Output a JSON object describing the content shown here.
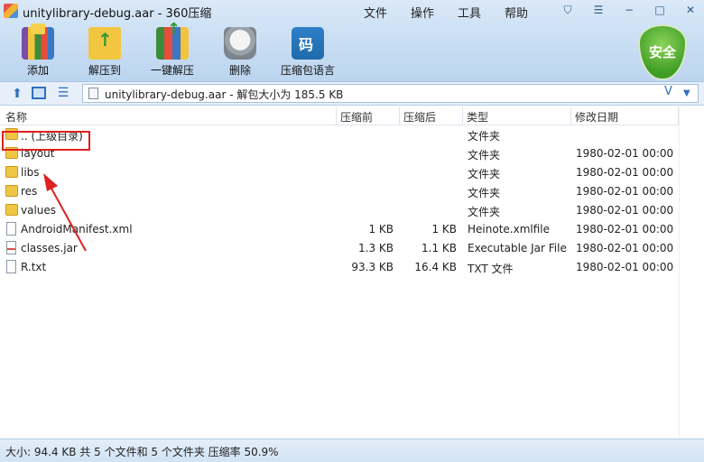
{
  "window": {
    "title": "unitylibrary-debug.aar - 360压缩",
    "menu": [
      "文件",
      "操作",
      "工具",
      "帮助"
    ],
    "controls": [
      "shirt-icon",
      "minimize",
      "maximize",
      "close"
    ]
  },
  "toolbar": {
    "buttons": [
      {
        "label": "添加",
        "icon": "add-archive-icon"
      },
      {
        "label": "解压到",
        "icon": "extract-to-icon"
      },
      {
        "label": "一键解压",
        "icon": "one-click-extract-icon"
      },
      {
        "label": "删除",
        "icon": "delete-icon"
      },
      {
        "label": "压缩包语言",
        "icon": "archive-language-icon"
      }
    ],
    "security_badge": "安全"
  },
  "address": {
    "path": "unitylibrary-debug.aar - 解包大小为 185.5 KB"
  },
  "table": {
    "columns": [
      "名称",
      "压缩前",
      "压缩后",
      "类型",
      "修改日期"
    ],
    "rows": [
      {
        "name": ".. (上级目录)",
        "before": "",
        "after": "",
        "type": "文件夹",
        "date": "",
        "icon": "folder-icon"
      },
      {
        "name": "layout",
        "before": "",
        "after": "",
        "type": "文件夹",
        "date": "1980-02-01 00:00",
        "icon": "folder-icon"
      },
      {
        "name": "libs",
        "before": "",
        "after": "",
        "type": "文件夹",
        "date": "1980-02-01 00:00",
        "icon": "folder-icon"
      },
      {
        "name": "res",
        "before": "",
        "after": "",
        "type": "文件夹",
        "date": "1980-02-01 00:00",
        "icon": "folder-icon"
      },
      {
        "name": "values",
        "before": "",
        "after": "",
        "type": "文件夹",
        "date": "1980-02-01 00:00",
        "icon": "folder-icon"
      },
      {
        "name": "AndroidManifest.xml",
        "before": "1 KB",
        "after": "1 KB",
        "type": "Heinote.xmlfile",
        "date": "1980-02-01 00:00",
        "icon": "file-icon"
      },
      {
        "name": "classes.jar",
        "before": "1.3 KB",
        "after": "1.1 KB",
        "type": "Executable Jar File",
        "date": "1980-02-01 00:00",
        "icon": "jar-file-icon"
      },
      {
        "name": "R.txt",
        "before": "93.3 KB",
        "after": "16.4 KB",
        "type": "TXT 文件",
        "date": "1980-02-01 00:00",
        "icon": "file-icon"
      }
    ]
  },
  "status": {
    "text": "大小: 94.4 KB 共 5 个文件和 5 个文件夹 压缩率 50.9%"
  },
  "annotation_color": "#e02020"
}
